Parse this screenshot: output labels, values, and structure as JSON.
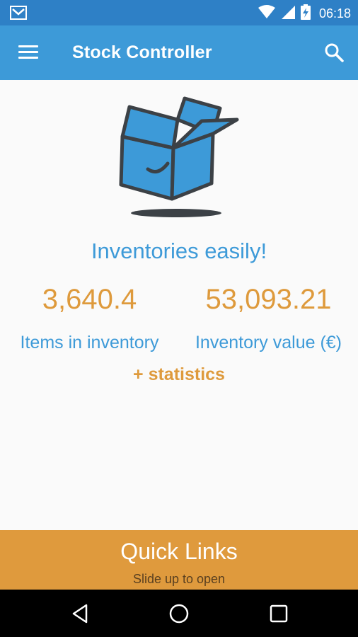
{
  "status_bar": {
    "time": "06:18",
    "icons": [
      "gmail-icon",
      "wifi-icon",
      "signal-icon",
      "battery-charging-icon"
    ]
  },
  "app_bar": {
    "title": "Stock Controller",
    "menu_icon": "hamburger-menu-icon",
    "search_icon": "search-icon"
  },
  "hero": {
    "illustration": "box-icon",
    "tagline": "Inventories easily!"
  },
  "stats": {
    "items": {
      "value": "3,640.4",
      "label": "Items in inventory"
    },
    "value": {
      "value": "53,093.21",
      "label": "Inventory value (€)"
    },
    "more_link": "+ statistics"
  },
  "quick_links": {
    "title": "Quick Links",
    "subtitle": "Slide up to open"
  },
  "nav_bar": {
    "buttons": [
      "back-icon",
      "home-icon",
      "recents-icon"
    ]
  },
  "colors": {
    "primary": "#3d9ad8",
    "primary_dark": "#2e80c6",
    "accent": "#de9a3c"
  }
}
